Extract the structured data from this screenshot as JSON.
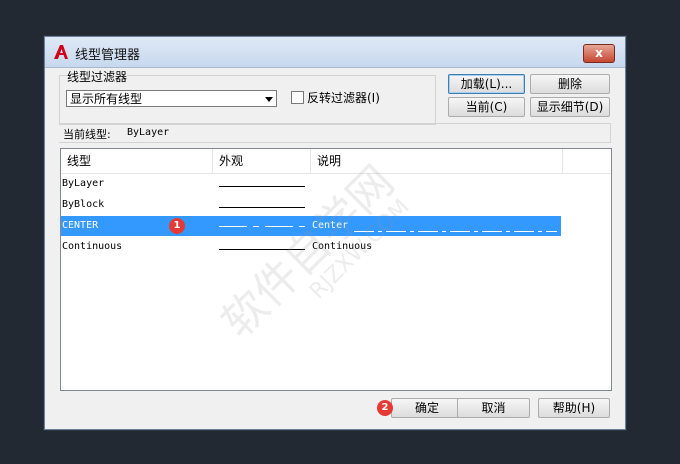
{
  "window": {
    "title": "线型管理器",
    "close": "x"
  },
  "filter": {
    "group_label": "线型过滤器",
    "selected": "显示所有线型",
    "invert_label": "反转过滤器(I)"
  },
  "buttons": {
    "load": "加载(L)...",
    "delete": "删除",
    "current": "当前(C)",
    "details": "显示细节(D)",
    "ok": "确定",
    "cancel": "取消",
    "help": "帮助(H)"
  },
  "current_linetype": {
    "label": "当前线型:",
    "value": "ByLayer"
  },
  "table": {
    "headers": [
      "线型",
      "外观",
      "说明"
    ],
    "rows": [
      {
        "name": "ByLayer",
        "desc": ""
      },
      {
        "name": "ByBlock",
        "desc": ""
      },
      {
        "name": "CENTER",
        "desc": "Center"
      },
      {
        "name": "Continuous",
        "desc": "Continuous"
      }
    ]
  },
  "badges": [
    "1",
    "2"
  ],
  "watermark": {
    "main": "软件自学网",
    "sub": "RJZXW.COM"
  },
  "colors": {
    "selection": "#3399ff",
    "badge": "#e53935",
    "background": "#222933"
  }
}
